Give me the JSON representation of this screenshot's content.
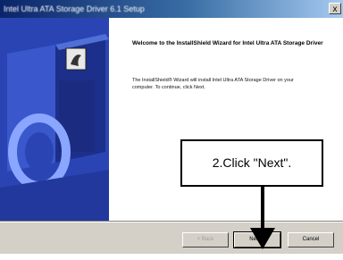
{
  "window": {
    "title": "Intel Ultra ATA Storage Driver 6.1 Setup",
    "close_glyph": "x"
  },
  "content": {
    "welcome": "Welcome to the InstallShield Wizard for Intel Ultra ATA Storage Driver",
    "description": "The InstallShield® Wizard will install Intel Ultra ATA Storage Driver on your computer. To continue, click Next."
  },
  "buttons": {
    "back": "< Back",
    "next": "Next >",
    "cancel": "Cancel"
  },
  "callout": {
    "text": "2.Click \"Next\"."
  },
  "colors": {
    "title_bar": "#0a246a",
    "art_background": "#2a44b4",
    "dialog": "#d4d0c8"
  },
  "icons": [
    "installer-box-icon",
    "arrow-down-icon"
  ]
}
